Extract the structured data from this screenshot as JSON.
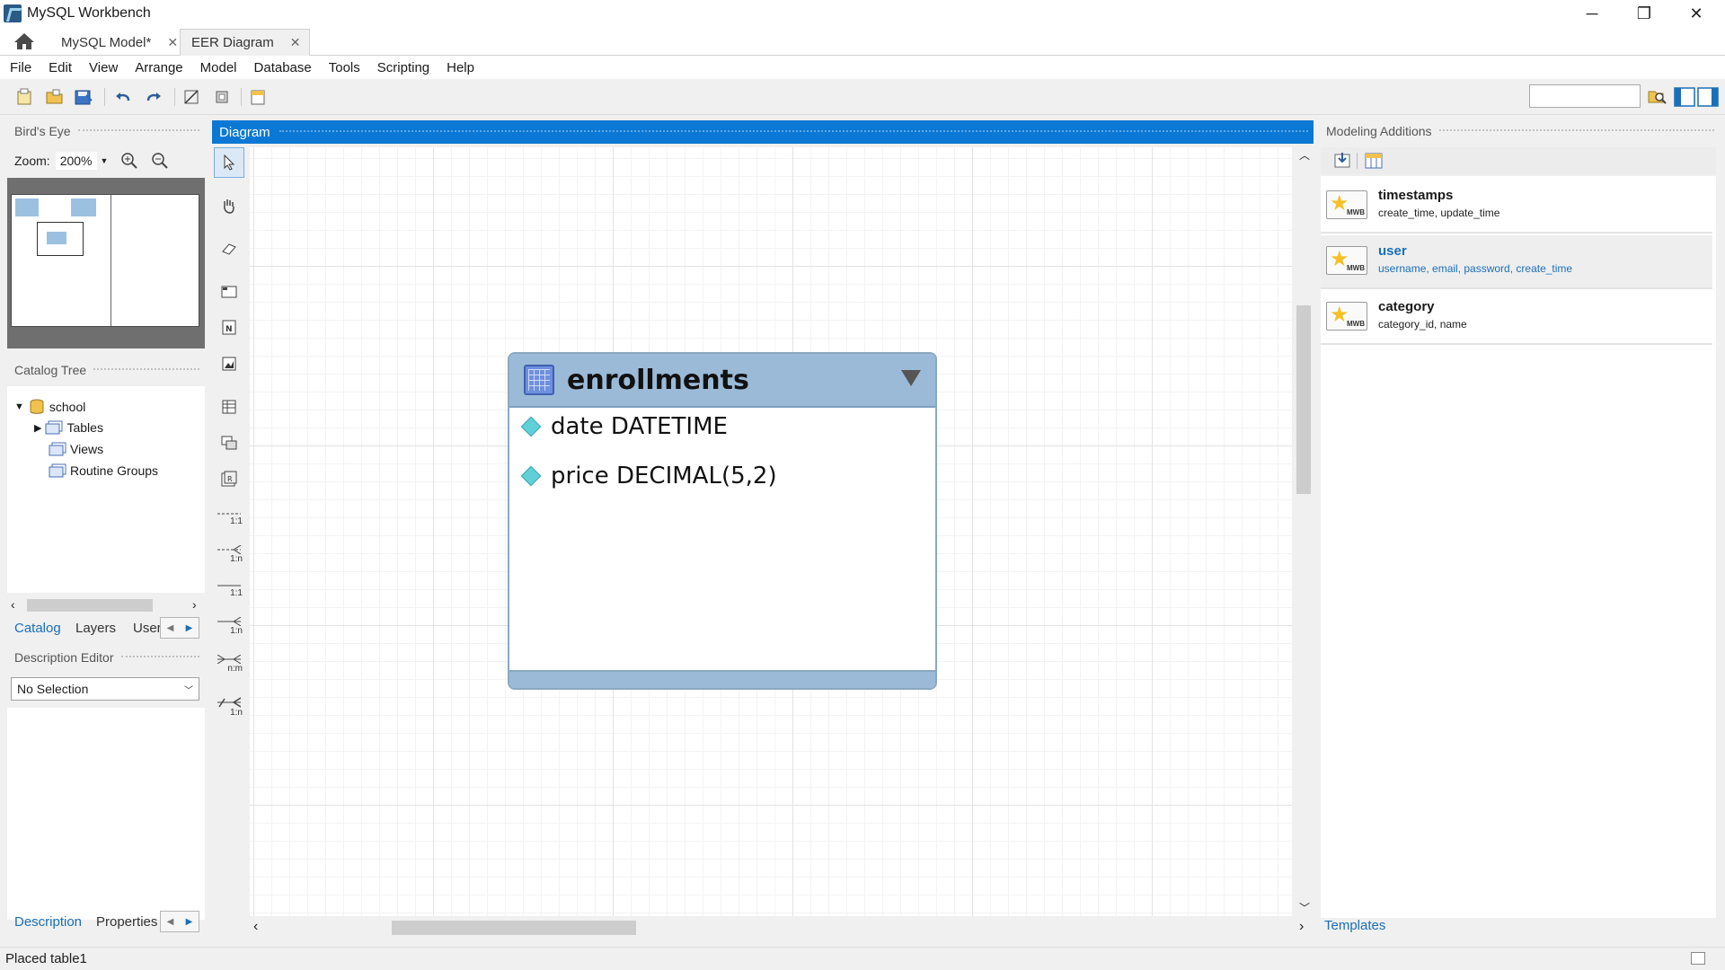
{
  "window": {
    "title": "MySQL Workbench",
    "controls": {
      "minimize": "─",
      "maximize": "❐",
      "close": "✕"
    }
  },
  "doc_tabs": [
    {
      "label": "MySQL Model*",
      "close": "✕"
    },
    {
      "label": "EER Diagram",
      "close": "✕"
    }
  ],
  "menu": [
    "File",
    "Edit",
    "View",
    "Arrange",
    "Model",
    "Database",
    "Tools",
    "Scripting",
    "Help"
  ],
  "birds_eye": {
    "header": "Bird's Eye",
    "zoom_label": "Zoom:",
    "zoom_value": "200%"
  },
  "catalog": {
    "header": "Catalog Tree",
    "schema": "school",
    "children": [
      "Tables",
      "Views",
      "Routine Groups"
    ],
    "tabs": [
      "Catalog",
      "Layers",
      "User"
    ]
  },
  "description": {
    "header": "Description Editor",
    "select_value": "No Selection",
    "tabs": [
      "Description",
      "Properties"
    ]
  },
  "diagram": {
    "header": "Diagram",
    "entity": {
      "name": "enrollments",
      "columns": [
        "date DATETIME",
        "price DECIMAL(5,2)"
      ]
    }
  },
  "tool_labels": [
    "1:1",
    "1:n",
    "1:1",
    "1:n",
    "n:m",
    "1:n"
  ],
  "modeling_additions": {
    "header": "Modeling Additions",
    "badge": "MWB",
    "snippets": [
      {
        "title": "timestamps",
        "subtitle": "create_time, update_time"
      },
      {
        "title": "user",
        "subtitle": "username, email, password, create_time"
      },
      {
        "title": "category",
        "subtitle": "category_id, name"
      }
    ],
    "tab": "Templates"
  },
  "status": {
    "text": "Placed table1"
  },
  "colors": {
    "accent": "#0a78d4",
    "entity_header": "#9bbad7",
    "link": "#1a6fb8"
  }
}
